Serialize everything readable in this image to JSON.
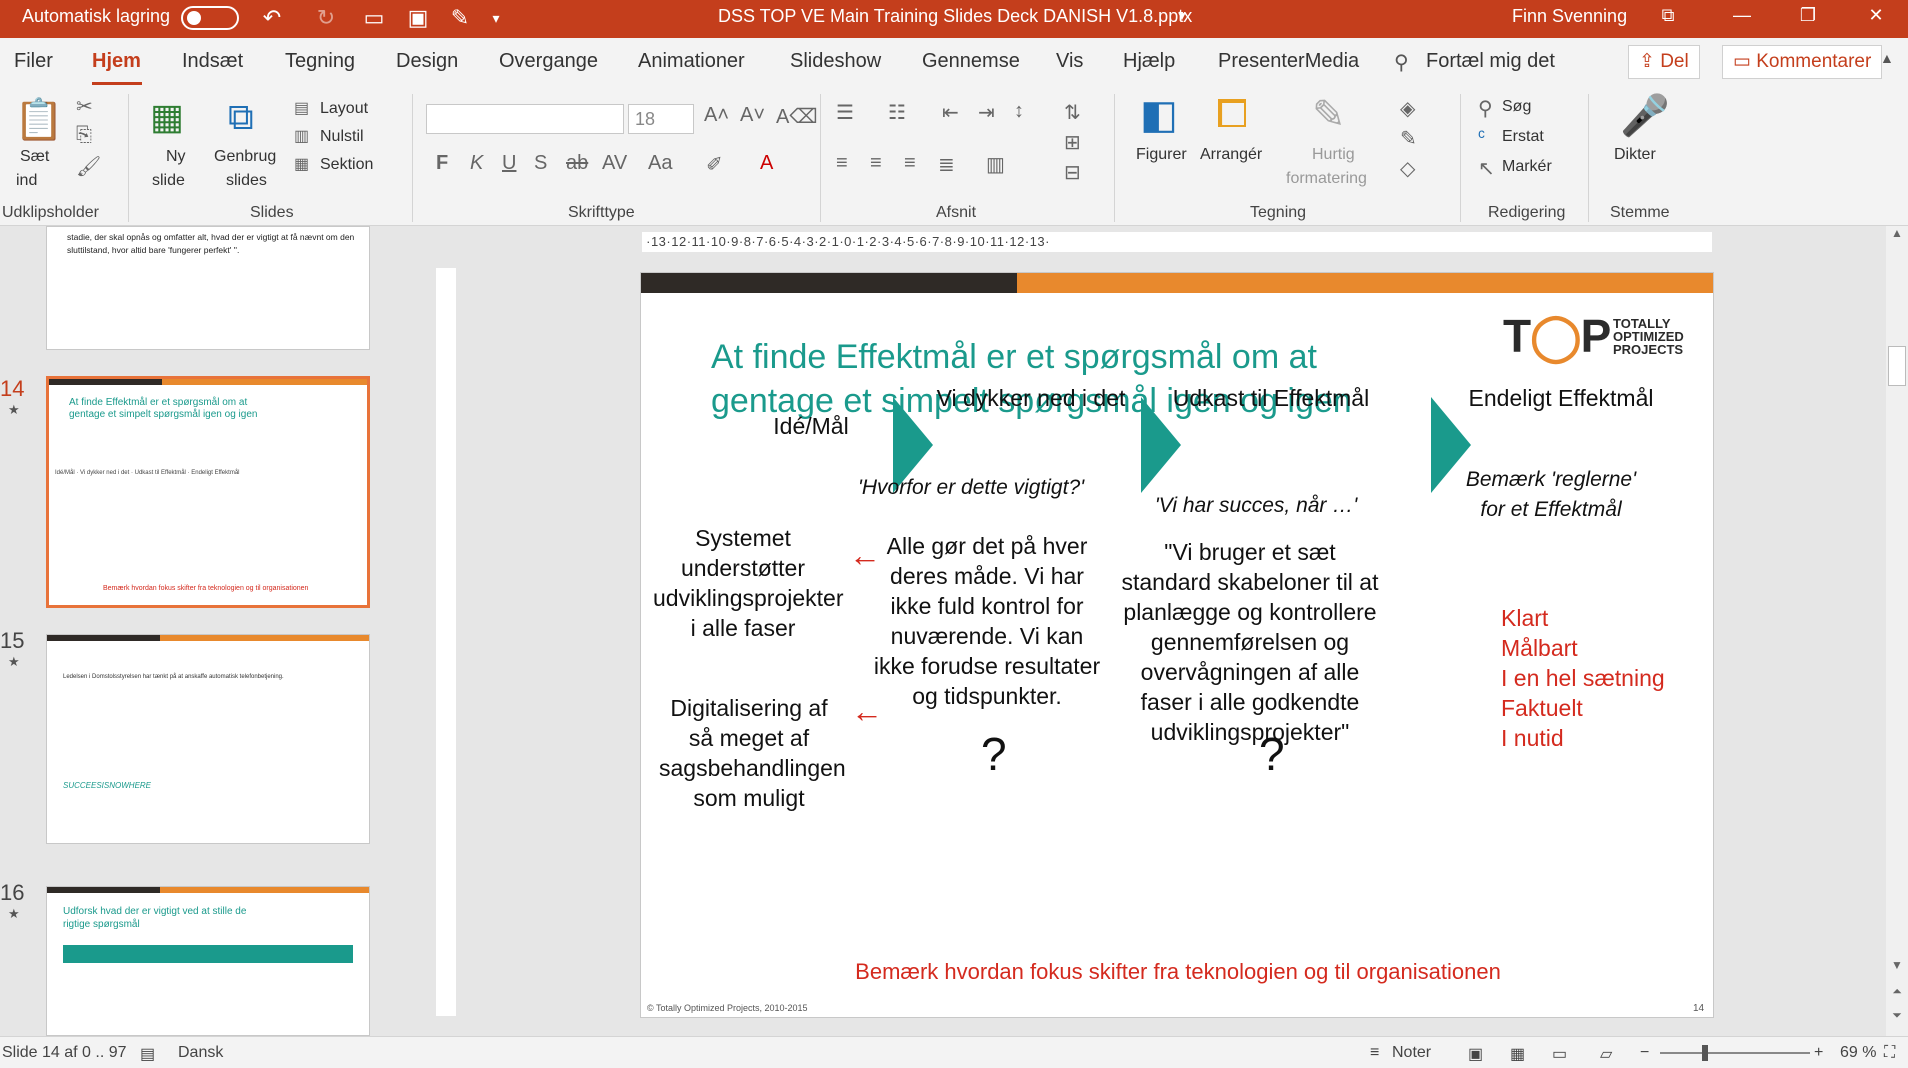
{
  "titlebar": {
    "autosave_label": "Automatisk lagring",
    "doc_title": "DSS TOP VE Main Training Slides Deck DANISH V1.8.pptx",
    "user": "Finn Svenning",
    "bg_color": "#c43e1c"
  },
  "tabs": [
    "Filer",
    "Hjem",
    "Indsæt",
    "Tegning",
    "Design",
    "Overgange",
    "Animationer",
    "Slideshow",
    "Gennemse",
    "Vis",
    "Hjælp",
    "PresenterMedia"
  ],
  "tellme": "Fortæl mig det",
  "share": "Del",
  "comments": "Kommentarer",
  "ribbon": {
    "paste": [
      "Sæt",
      "ind"
    ],
    "clipboard_group": "Udklipsholder",
    "new_slide": [
      "Ny",
      "slide"
    ],
    "reuse_slides": [
      "Genbrug",
      "slides"
    ],
    "layout": "Layout",
    "reset": "Nulstil",
    "section": "Sektion",
    "slides_group": "Slides",
    "font_size": "18",
    "font_group": "Skrifttype",
    "paragraph_group": "Afsnit",
    "shapes": "Figurer",
    "arrange": "Arrangér",
    "quick_styles": [
      "Hurtig",
      "formatering"
    ],
    "drawing_group": "Tegning",
    "find": "Søg",
    "replace": "Erstat",
    "select": "Markér",
    "editing_group": "Redigering",
    "dictate": "Dikter",
    "voice_group": "Stemme"
  },
  "thumbnails": [
    {
      "num": "",
      "text": "stadie, der skal opnås og omfatter alt, hvad der er vigtigt at få nævnt om den sluttilstand, hvor altid bare 'fungerer perfekt' ''."
    },
    {
      "num": "14"
    },
    {
      "num": "15",
      "body": "Ledelsen i Domstolsstyrelsen har tænkt på at anskaffe automatisk telefonbetjening.",
      "footer": "SUCCEESISNOWHERE"
    },
    {
      "num": "16",
      "title": "Udforsk hvad der er vigtigt ved at stille de rigtige spørgsmål"
    }
  ],
  "slide": {
    "title": "At finde Effektmål er et spørgsmål om at gentage et simpelt spørgsmål igen og igen",
    "logo_text": "T P",
    "logo_sub": [
      "TOTALLY",
      "OPTIMIZED",
      "PROJECTS"
    ],
    "col1_head": "Idé/Mål",
    "col1_item1": "Systemet understøtter udviklingsprojekter i alle faser",
    "col1_item2": "Digitalisering af så meget af sagsbehandlingen som muligt",
    "col2_head": "Vi dykker ned i det",
    "col2_q": "'Hvorfor er dette vigtigt?'",
    "col2_body": "Alle gør det på hver deres måde. Vi har ikke fuld kontrol for nuværende. Vi kan ikke forudse resultater og tidspunkter.",
    "col3_head": "Udkast til Effektmål",
    "col3_q": "'Vi har succes, når …'",
    "col3_body": "\"Vi bruger et sæt standard skabeloner til at planlægge og kontrollere gennemførelsen og overvågningen af alle faser i alle godkendte udviklingsprojekter\"",
    "col4_head": "Endeligt Effektmål",
    "col4_q": "Bemærk 'reglerne' for et Effektmål",
    "rules": [
      "Klart",
      "Målbart",
      "I en hel sætning",
      "Faktuelt",
      "I nutid"
    ],
    "qmark": "?",
    "footnote": "Bemærk hvordan fokus skifter fra teknologien og til organisationen",
    "copyright": "© Totally Optimized Projects, 2010-2015",
    "page": "14",
    "accent_teal": "#1a9a8c",
    "accent_orange": "#e8892d",
    "accent_red": "#d42a1e"
  },
  "status": {
    "slide_info": "Slide 14 af 0 .. 97",
    "language": "Dansk",
    "notes": "Noter",
    "zoom": "69 %"
  }
}
